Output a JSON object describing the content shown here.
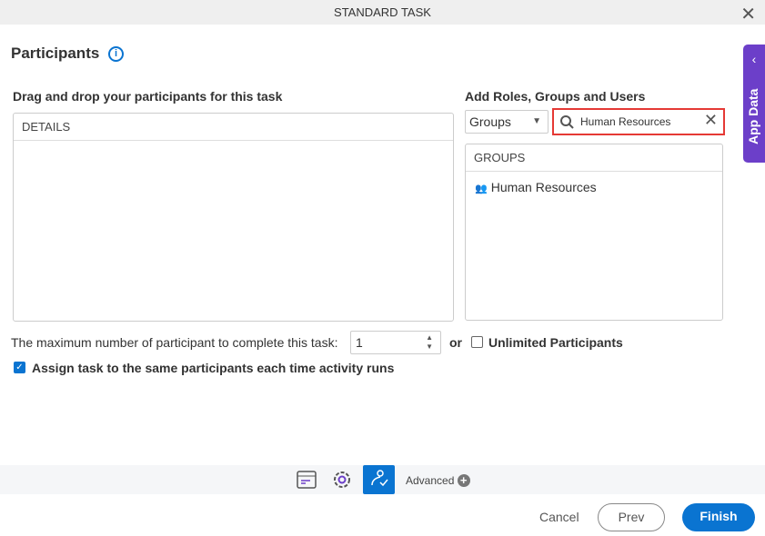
{
  "window": {
    "title": "STANDARD TASK"
  },
  "header": {
    "title": "Participants"
  },
  "left": {
    "label": "Drag and drop your participants for this task",
    "list_header": "DETAILS"
  },
  "right": {
    "label": "Add Roles, Groups and Users",
    "type_select": "Groups",
    "search_value": "Human Resources",
    "list_header": "GROUPS",
    "items": [
      {
        "label": "Human Resources",
        "icon": "group-icon"
      }
    ]
  },
  "options": {
    "max_label": "The maximum number of participant to complete this task:",
    "max_value": "1",
    "or": "or",
    "unlimited_label": "Unlimited Participants",
    "unlimited_checked": false,
    "assign_label": "Assign task to the same participants each time activity runs",
    "assign_checked": true
  },
  "side_panel": {
    "label": "App Data"
  },
  "toolbar": {
    "advanced": "Advanced"
  },
  "footer": {
    "cancel": "Cancel",
    "prev": "Prev",
    "finish": "Finish"
  },
  "colors": {
    "accent": "#0a74d1",
    "panel": "#6c3fc9",
    "search_border": "#e53935"
  }
}
